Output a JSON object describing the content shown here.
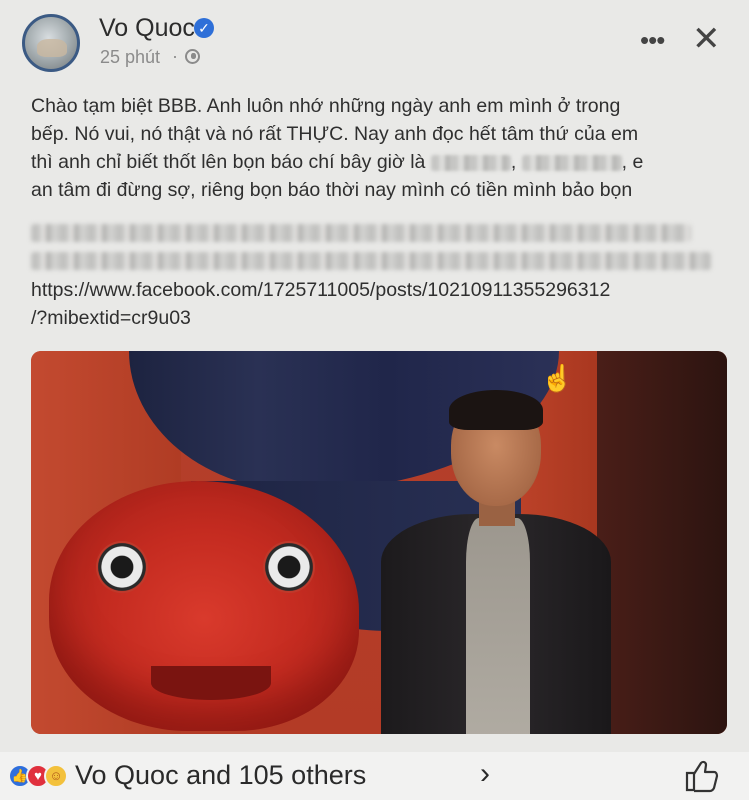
{
  "post": {
    "author": "Vo Quoc",
    "timestamp": "25 phút",
    "separator": "·",
    "more_label": "•••",
    "close_label": "✕",
    "body_lines": [
      "Chào tạm biệt BBB. Anh luôn nhớ những ngày anh em mình ở trong",
      "bếp. Nó vui, nó thật và nó rất THỰC. Nay anh đọc hết tâm thứ của em",
      "thì anh chỉ biết thốt lên bọn báo chí bây giờ là",
      "an tâm đi đừng sợ, riêng bọn báo thời nay mình có tiền mình bảo bọn"
    ],
    "line3_suffix_1": ",",
    "line3_suffix_2": ", e",
    "link_line_1": "https://www.facebook.com/1725711005/posts/10210911355296312",
    "link_line_2": "/?mibextid=cr9u03"
  },
  "reactions": {
    "summary": "Vo Quoc and 105 others",
    "chevron": "›",
    "types": [
      "like",
      "love",
      "care"
    ]
  },
  "colors": {
    "verified": "#2e6fd8",
    "like": "#2f6fdc",
    "love": "#e0303d",
    "care": "#f3c13c"
  }
}
